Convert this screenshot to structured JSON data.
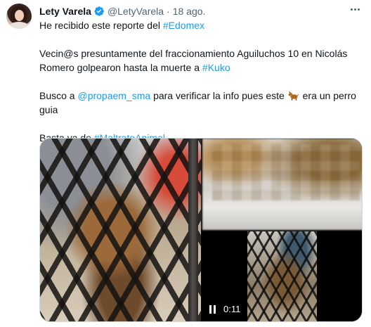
{
  "author": {
    "name": "Lety Varela",
    "handle": "@LetyVarela",
    "separator": "·",
    "date": "18 ago."
  },
  "tweet": {
    "line1_text": "He recibido este reporte del ",
    "line1_tag": "#Edomex",
    "para2_text": "Vecin@s presuntamente del fraccionamiento Aguiluchos 10 en Nicolás Romero golpearon hasta la muerte a ",
    "para2_tag": "#Kuko",
    "para3_before": "Busco a ",
    "para3_mention": "@propaem_sma",
    "para3_middle": " para verificar la info pues este ",
    "para3_after": " era un perro guia",
    "para4_text": "Basta ya de ",
    "para4_tag": "#MaltratoAnimal"
  },
  "media": {
    "video_time": "0:11"
  },
  "icons": {
    "verified": "verified-badge-icon",
    "more": "more-options-icon",
    "pause": "pause-icon",
    "emoji": "dog-emoji-icon"
  },
  "colors": {
    "link": "#1d9bf0",
    "text": "#0f1419",
    "muted": "#536471"
  }
}
